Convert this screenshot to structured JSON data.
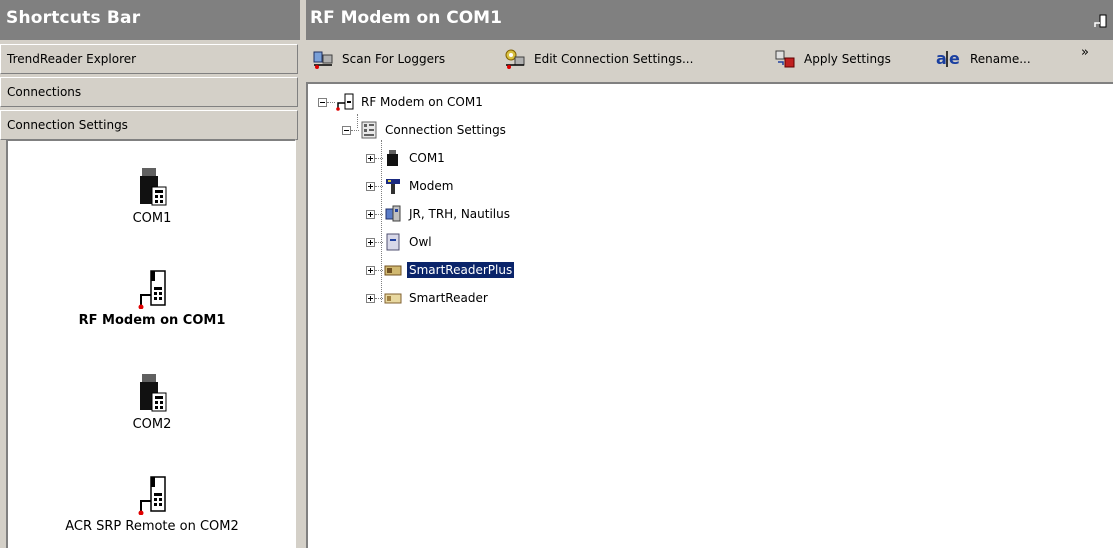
{
  "left": {
    "title": "Shortcuts Bar",
    "tabs": [
      "TrendReader Explorer",
      "Connections",
      "Connection Settings"
    ],
    "shortcuts": [
      {
        "label": "COM1",
        "icon": "serial-port-icon",
        "bold": false
      },
      {
        "label": "RF Modem on COM1",
        "icon": "rf-modem-icon",
        "bold": true
      },
      {
        "label": "COM2",
        "icon": "serial-port-icon",
        "bold": false
      },
      {
        "label": "ACR SRP Remote on COM2",
        "icon": "rf-modem-icon",
        "bold": false
      }
    ]
  },
  "right": {
    "title": "RF Modem on COM1",
    "toolbar": {
      "scan": "Scan For Loggers",
      "edit": "Edit Connection Settings...",
      "apply": "Apply Settings",
      "rename": "Rename...",
      "more": "»"
    },
    "tree": {
      "root": "RF Modem on COM1",
      "settings": "Connection Settings",
      "children": [
        "COM1",
        "Modem",
        "JR, TRH, Nautilus",
        "Owl",
        "SmartReaderPlus",
        "SmartReader"
      ],
      "selected": "SmartReaderPlus"
    }
  },
  "colors": {
    "title_bar": "#808080",
    "selection": "#0a246a",
    "chrome": "#d4d0c8"
  }
}
